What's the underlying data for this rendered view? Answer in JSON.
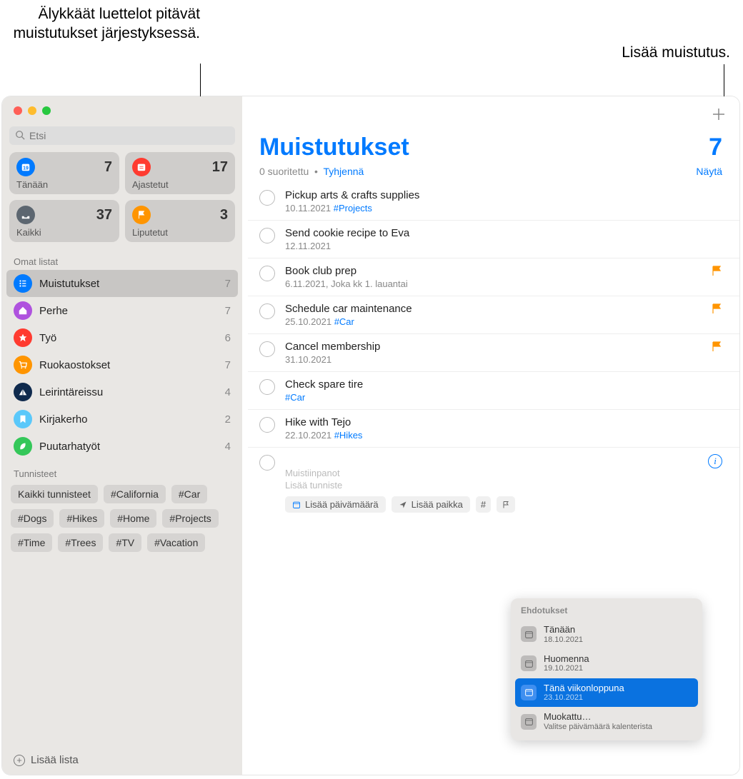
{
  "callouts": {
    "smart_lists": "Älykkäät luettelot pitävät muistutukset järjestyksessä.",
    "add_reminder": "Lisää muistutus."
  },
  "sidebar": {
    "search_placeholder": "Etsi",
    "smart": {
      "today": {
        "label": "Tänään",
        "count": "7"
      },
      "scheduled": {
        "label": "Ajastetut",
        "count": "17"
      },
      "all": {
        "label": "Kaikki",
        "count": "37"
      },
      "flagged": {
        "label": "Liputetut",
        "count": "3"
      }
    },
    "my_lists_header": "Omat listat",
    "lists": [
      {
        "name": "Muistutukset",
        "count": "7",
        "color": "#007aff",
        "selected": true,
        "icon": "list"
      },
      {
        "name": "Perhe",
        "count": "7",
        "color": "#af52de",
        "icon": "home"
      },
      {
        "name": "Työ",
        "count": "6",
        "color": "#ff3b30",
        "icon": "star"
      },
      {
        "name": "Ruokaostokset",
        "count": "7",
        "color": "#ff9500",
        "icon": "cart"
      },
      {
        "name": "Leirintäreissu",
        "count": "4",
        "color": "#0f2a4d",
        "icon": "tent"
      },
      {
        "name": "Kirjakerho",
        "count": "2",
        "color": "#5ac8fa",
        "icon": "bookmark"
      },
      {
        "name": "Puutarhatyöt",
        "count": "4",
        "color": "#34c759",
        "icon": "leaf"
      }
    ],
    "tags_header": "Tunnisteet",
    "tags": [
      "Kaikki tunnisteet",
      "#California",
      "#Car",
      "#Dogs",
      "#Hikes",
      "#Home",
      "#Projects",
      "#Time",
      "#Trees",
      "#TV",
      "#Vacation"
    ],
    "add_list": "Lisää lista"
  },
  "main": {
    "title": "Muistutukset",
    "count": "7",
    "completed_text": "0 suoritettu",
    "clear": "Tyhjennä",
    "show": "Näytä",
    "reminders": [
      {
        "title": "Pickup arts & crafts supplies",
        "sub": "10.11.2021",
        "tag": "#Projects"
      },
      {
        "title": "Send cookie recipe to Eva",
        "sub": "12.11.2021"
      },
      {
        "title": "Book club prep",
        "sub": "6.11.2021, Joka kk 1. lauantai",
        "flagged": true
      },
      {
        "title": "Schedule car maintenance",
        "sub": "25.10.2021",
        "tag": "#Car",
        "flagged": true
      },
      {
        "title": "Cancel membership",
        "sub": "31.10.2021",
        "flagged": true
      },
      {
        "title": "Check spare tire",
        "tag": "#Car"
      },
      {
        "title": "Hike with Tejo",
        "sub": "22.10.2021",
        "tag": "#Hikes"
      }
    ],
    "new_reminder": {
      "notes_placeholder": "Muistiinpanot",
      "add_tag_placeholder": "Lisää tunniste",
      "add_date": "Lisää päivämäärä",
      "add_location": "Lisää paikka"
    },
    "popover": {
      "header": "Ehdotukset",
      "suggestions": [
        {
          "title": "Tänään",
          "date": "18.10.2021"
        },
        {
          "title": "Huomenna",
          "date": "19.10.2021"
        },
        {
          "title": "Tänä viikonloppuna",
          "date": "23.10.2021",
          "selected": true
        },
        {
          "title": "Muokattu…",
          "date": "Valitse päivämäärä kalenterista"
        }
      ]
    }
  }
}
